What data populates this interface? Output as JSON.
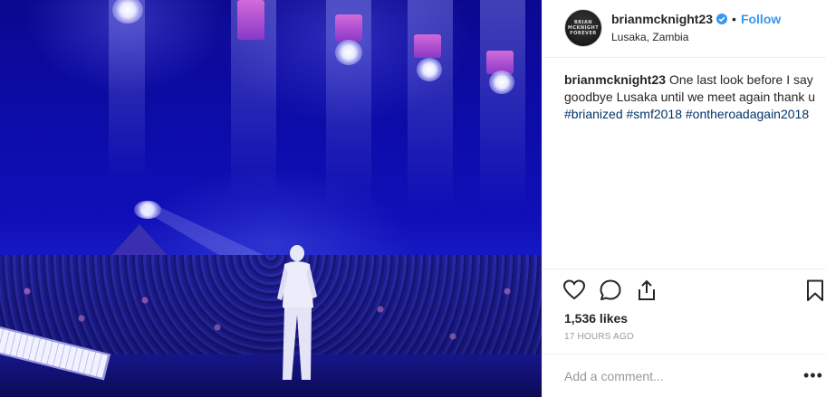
{
  "post": {
    "username": "brianmcknight23",
    "separator": "•",
    "follow_label": "Follow",
    "location": "Lusaka, Zambia",
    "avatar_text": [
      "BRIAN",
      "MCKNIGHT",
      "FOREVER"
    ],
    "caption": {
      "text": "One last look before I say goodbye Lusaka until we meet again thank u",
      "hashtags": [
        "#brianized",
        "#smf2018",
        "#ontheroadagain2018"
      ]
    },
    "likes": "1,536 likes",
    "timestamp": "17 HOURS AGO",
    "comment_placeholder": "Add a comment...",
    "more_label": "•••"
  },
  "colors": {
    "accent": "#3897f0",
    "hashtag": "#003569",
    "muted": "#999999",
    "text": "#262626",
    "verified": "#3897f0"
  },
  "icons": [
    "heart-icon",
    "comment-icon",
    "share-icon",
    "bookmark-icon",
    "verified-badge-icon",
    "more-options-icon"
  ]
}
